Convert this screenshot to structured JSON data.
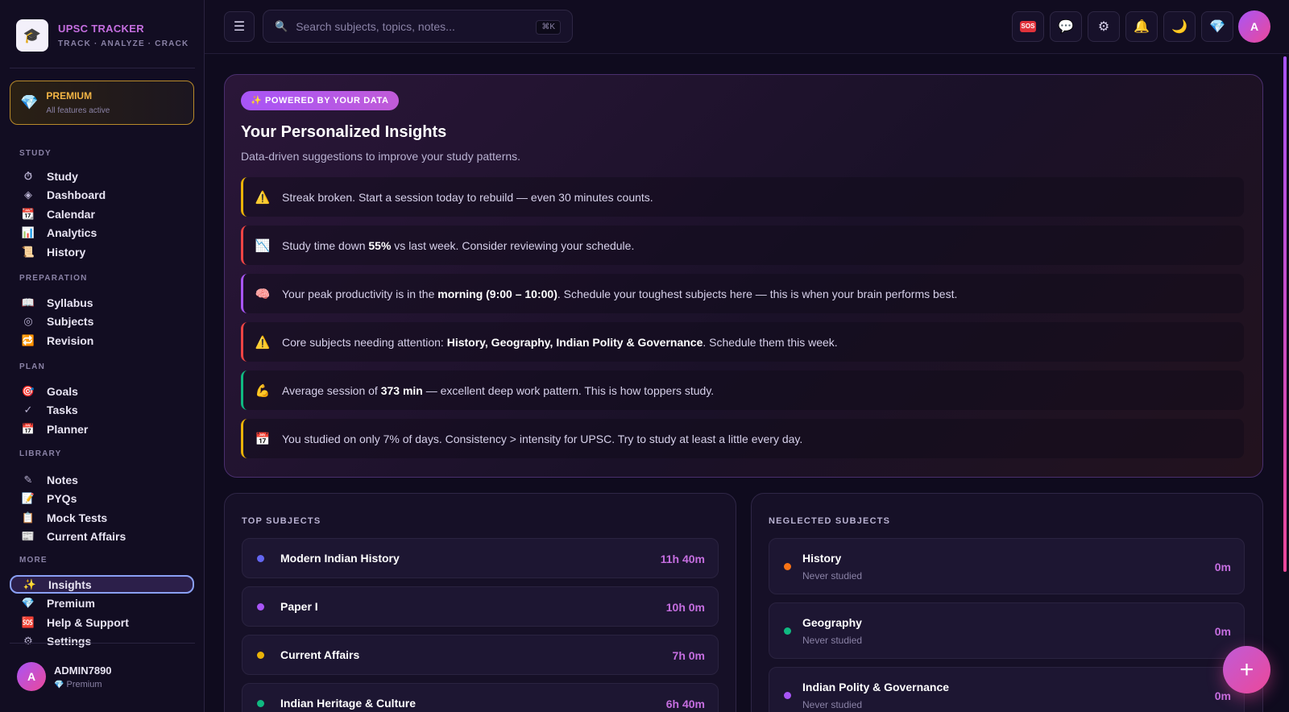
{
  "brand": {
    "title": "UPSC TRACKER",
    "subtitle": "TRACK · ANALYZE · CRACK",
    "logo_icon": "study-logo-icon"
  },
  "premium_card": {
    "title": "PREMIUM",
    "subtitle": "All features active"
  },
  "sidebar": {
    "sections": [
      {
        "title": "STUDY",
        "items": [
          {
            "label": "Study",
            "icon": "⏱"
          },
          {
            "label": "Dashboard",
            "icon": "◈"
          },
          {
            "label": "Calendar",
            "icon": "📆"
          },
          {
            "label": "Analytics",
            "icon": "📊"
          },
          {
            "label": "History",
            "icon": "📜"
          }
        ]
      },
      {
        "title": "PREPARATION",
        "items": [
          {
            "label": "Syllabus",
            "icon": "📖"
          },
          {
            "label": "Subjects",
            "icon": "◎"
          },
          {
            "label": "Revision",
            "icon": "🔁"
          }
        ]
      },
      {
        "title": "PLAN",
        "items": [
          {
            "label": "Goals",
            "icon": "🎯"
          },
          {
            "label": "Tasks",
            "icon": "✓"
          },
          {
            "label": "Planner",
            "icon": "📅"
          }
        ]
      },
      {
        "title": "LIBRARY",
        "items": [
          {
            "label": "Notes",
            "icon": "✎"
          },
          {
            "label": "PYQs",
            "icon": "📝"
          },
          {
            "label": "Mock Tests",
            "icon": "📋"
          },
          {
            "label": "Current Affairs",
            "icon": "📰"
          }
        ]
      },
      {
        "title": "MORE",
        "items": [
          {
            "label": "Insights",
            "icon": "✨"
          },
          {
            "label": "Premium",
            "icon": "💎"
          },
          {
            "label": "Help & Support",
            "icon": "🆘"
          },
          {
            "label": "Settings",
            "icon": "⚙"
          }
        ]
      }
    ],
    "active_item": "Insights"
  },
  "user": {
    "initial": "A",
    "name": "ADMIN7890",
    "plan": "Premium"
  },
  "topbar": {
    "search_placeholder": "Search subjects, topics, notes...",
    "search_shortcut": "⌘K",
    "avatar_initial": "A",
    "sos_label": "SOS"
  },
  "insights": {
    "badge": "✨ POWERED BY YOUR DATA",
    "title": "Your Personalized Insights",
    "subtitle": "Data-driven suggestions to improve your study patterns.",
    "rows": [
      {
        "icon": "⚠️",
        "accent": "#eab308",
        "before": "Streak broken. Start a session today to rebuild — even 30 minutes counts.",
        "bold": "",
        "after": ""
      },
      {
        "icon": "📉",
        "accent": "#ef4444",
        "before": "Study time down ",
        "bold": "55%",
        "after": " vs last week. Consider reviewing your schedule."
      },
      {
        "icon": "🧠",
        "accent": "#a855f7",
        "before": "Your peak productivity is in the ",
        "bold": "morning (9:00 – 10:00)",
        "after": ". Schedule your toughest subjects here — this is when your brain performs best."
      },
      {
        "icon": "⚠️",
        "accent": "#ef4444",
        "before": "Core subjects needing attention: ",
        "bold": "History, Geography, Indian Polity & Governance",
        "after": ". Schedule them this week."
      },
      {
        "icon": "💪",
        "accent": "#10b981",
        "before": "Average session of ",
        "bold": "373 min",
        "after": " — excellent deep work pattern. This is how toppers study."
      },
      {
        "icon": "📅",
        "accent": "#eab308",
        "before": "You studied on only 7% of days. Consistency > intensity for UPSC. Try to study at least a little every day.",
        "bold": "",
        "after": ""
      }
    ]
  },
  "top_subjects": {
    "title": "TOP SUBJECTS",
    "items": [
      {
        "name": "Modern Indian History",
        "time": "11h 40m",
        "color": "#6366f1"
      },
      {
        "name": "Paper I",
        "time": "10h 0m",
        "color": "#a855f7"
      },
      {
        "name": "Current Affairs",
        "time": "7h 0m",
        "color": "#eab308"
      },
      {
        "name": "Indian Heritage & Culture",
        "time": "6h 40m",
        "color": "#10b981"
      }
    ]
  },
  "neglected_subjects": {
    "title": "NEGLECTED SUBJECTS",
    "items": [
      {
        "name": "History",
        "status": "Never studied",
        "time": "0m",
        "color": "#f97316"
      },
      {
        "name": "Geography",
        "status": "Never studied",
        "time": "0m",
        "color": "#10b981"
      },
      {
        "name": "Indian Polity & Governance",
        "status": "Never studied",
        "time": "0m",
        "color": "#a855f7"
      }
    ]
  }
}
